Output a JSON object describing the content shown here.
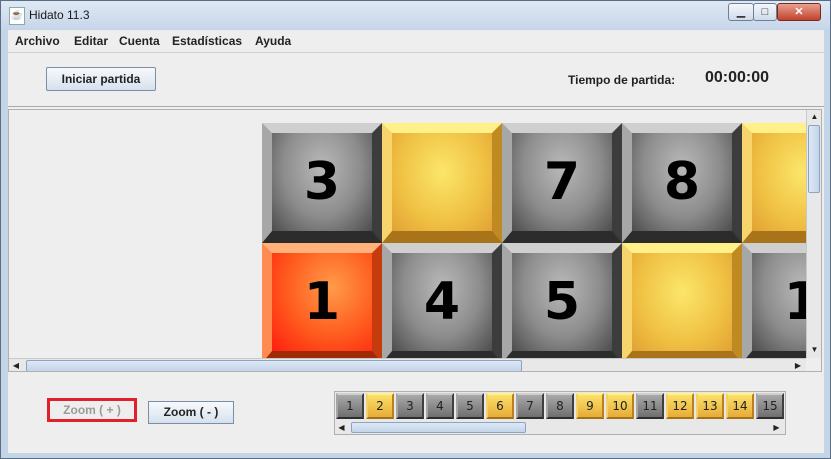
{
  "window": {
    "title": "Hidato 11.3",
    "minimize": "▁",
    "maximize": "□",
    "close": "✕",
    "app_icon": "java-icon"
  },
  "menu": {
    "items": [
      "Archivo",
      "Editar",
      "Cuenta",
      "Estadísticas",
      "Ayuda"
    ]
  },
  "toolbar": {
    "start_label": "Iniciar partida",
    "time_label": "Tiempo de partida:",
    "time_value": "00:00:00"
  },
  "board": {
    "rows": [
      [
        {
          "value": "3",
          "color": "gray"
        },
        {
          "value": "",
          "color": "yellow"
        },
        {
          "value": "7",
          "color": "gray"
        },
        {
          "value": "8",
          "color": "gray"
        },
        {
          "value": "",
          "color": "yellow"
        }
      ],
      [
        {
          "value": "1",
          "color": "red"
        },
        {
          "value": "4",
          "color": "gray"
        },
        {
          "value": "5",
          "color": "gray"
        },
        {
          "value": "",
          "color": "yellow"
        },
        {
          "value": "1",
          "color": "gray"
        }
      ]
    ],
    "colors": {
      "gray": "#8c8c8c",
      "yellow": "#f0c143",
      "red": "#ff4a1a"
    }
  },
  "zoom": {
    "plus_label": "Zoom ( + )",
    "minus_label": "Zoom ( - )",
    "plus_enabled": false
  },
  "palette": {
    "tiles": [
      {
        "value": "1",
        "color": "gray"
      },
      {
        "value": "2",
        "color": "yellow"
      },
      {
        "value": "3",
        "color": "gray"
      },
      {
        "value": "4",
        "color": "gray"
      },
      {
        "value": "5",
        "color": "gray"
      },
      {
        "value": "6",
        "color": "yellow"
      },
      {
        "value": "7",
        "color": "gray"
      },
      {
        "value": "8",
        "color": "gray"
      },
      {
        "value": "9",
        "color": "yellow"
      },
      {
        "value": "10",
        "color": "yellow"
      },
      {
        "value": "11",
        "color": "gray"
      },
      {
        "value": "12",
        "color": "yellow"
      },
      {
        "value": "13",
        "color": "yellow"
      },
      {
        "value": "14",
        "color": "yellow"
      },
      {
        "value": "15",
        "color": "gray"
      }
    ]
  }
}
